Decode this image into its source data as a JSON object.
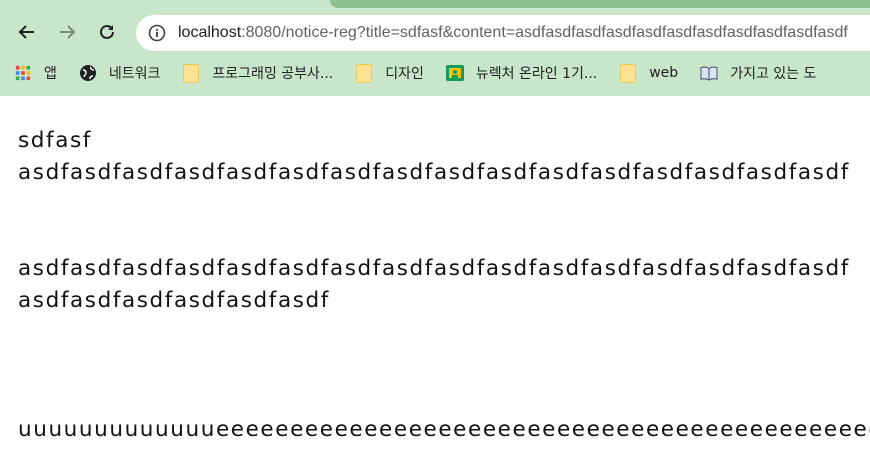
{
  "browser": {
    "url_host": "localhost",
    "url_rest": ":8080/notice-reg?title=sdfasf&content=asdfasdfasdfasdfasdfasdfasdfasdfasdfasdfasdf",
    "bookmarks": [
      {
        "label": "앱",
        "icon": "apps-grid-icon"
      },
      {
        "label": "네트워크",
        "icon": "globe-icon"
      },
      {
        "label": "프로그래밍 공부사...",
        "icon": "folder-icon"
      },
      {
        "label": "디자인",
        "icon": "folder-icon"
      },
      {
        "label": "뉴렉처 온라인 1기...",
        "icon": "classroom-icon"
      },
      {
        "label": "web",
        "icon": "folder-icon"
      },
      {
        "label": "가지고 있는 도",
        "icon": "book-icon"
      }
    ]
  },
  "page": {
    "title": "sdfasf",
    "line1": "asdfasdfasdfasdfasdfasdfasdfasdfasdfasdfasdfasdfasdfasdfasdfasdf",
    "line2": "asdfasdfasdfasdfasdfasdfasdfasdfasdfasdfasdfasdfasdfasdfasdfasdf",
    "line3": "asdfasdfasdfasdfasdfasdf",
    "line4": "uuuuuuuuuuuuueeeeeeeeeeeeeeeeeeeeeeeeeeeeeeeeeeeeeeeeeeeeeeeeeeaaaa"
  }
}
